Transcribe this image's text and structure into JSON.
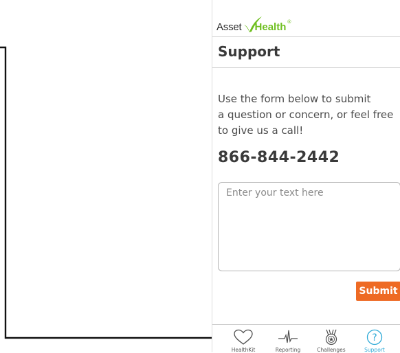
{
  "brand": {
    "name_part1": "Asset",
    "name_part2": "Health",
    "reg_mark": "®",
    "colors": {
      "accent": "#6fbf20",
      "text": "#2a2a2a"
    }
  },
  "page": {
    "title": "Support"
  },
  "intro": {
    "lines": [
      "Use the form below to submit",
      "a question or concern, or feel free",
      "to give us a call!"
    ]
  },
  "contact": {
    "phone": "866-844-2442"
  },
  "form": {
    "message_value": "",
    "message_placeholder": "Enter your text here",
    "submit_label": "Submit",
    "submit_color": "#ee6a24"
  },
  "tabs": [
    {
      "label": "HealthKit",
      "icon": "heart-icon",
      "active": false
    },
    {
      "label": "Reporting",
      "icon": "heartbeat-icon",
      "active": false
    },
    {
      "label": "Challenges",
      "icon": "medal-icon",
      "active": false
    },
    {
      "label": "Support",
      "icon": "question-circle-icon",
      "active": true
    }
  ],
  "colors": {
    "active_tab": "#29a8d6",
    "divider": "#d6d6d6"
  }
}
